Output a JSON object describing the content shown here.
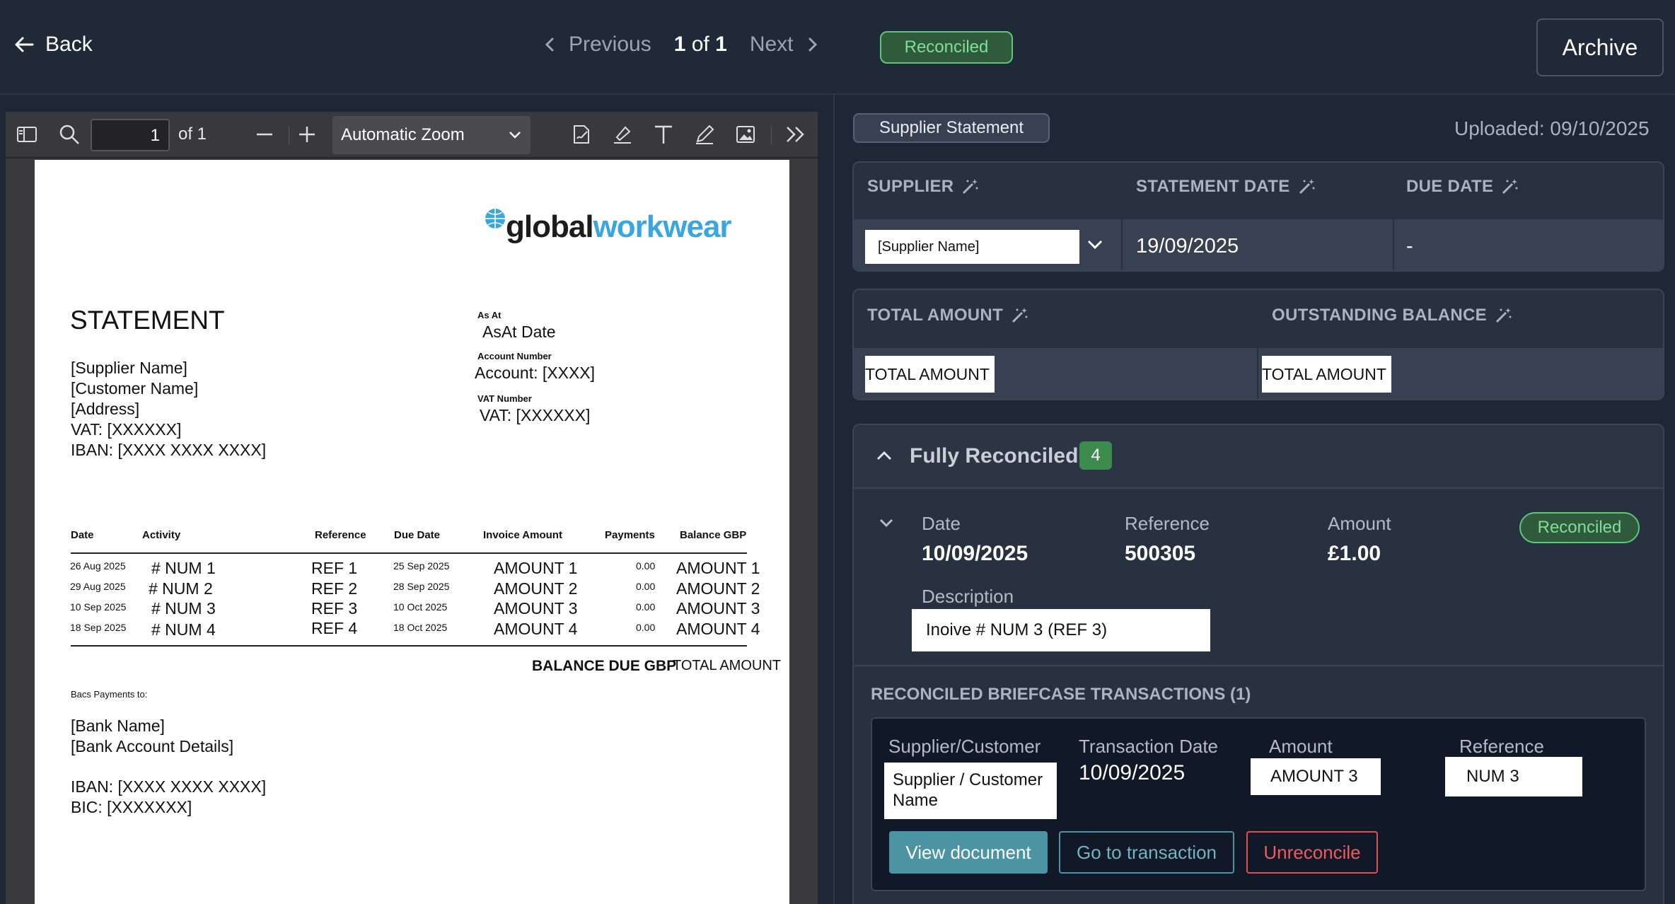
{
  "topbar": {
    "back": "Back",
    "previous": "Previous",
    "page_current": "1",
    "page_of": "of",
    "page_total": "1",
    "next": "Next",
    "status": "Reconciled",
    "archive": "Archive"
  },
  "pdf_toolbar": {
    "page_input": "1",
    "page_of": "of 1",
    "zoom": "Automatic Zoom"
  },
  "document": {
    "logo_a": "global",
    "logo_b": "workwear",
    "title": "STATEMENT",
    "as_at_label": "As At",
    "as_at_value": "AsAt Date",
    "account_label": "Account Number",
    "account_value": "Account: [XXXX]",
    "vat_label": "VAT Number",
    "vat_value": "VAT: [XXXXXX]",
    "address_lines": [
      "[Supplier Name]",
      "[Customer Name]",
      "[Address]",
      "VAT: [XXXXXX]",
      "IBAN: [XXXX XXXX XXXX]"
    ],
    "columns": [
      "Date",
      "Activity",
      "Reference",
      "Due Date",
      "Invoice Amount",
      "Payments",
      "Balance GBP"
    ],
    "rows": [
      [
        "26 Aug 2025",
        "# NUM 1",
        "REF 1",
        "25 Sep 2025",
        "AMOUNT 1",
        "0.00",
        "AMOUNT 1"
      ],
      [
        "29 Aug 2025",
        "# NUM 2",
        "REF 2",
        "28 Sep 2025",
        "AMOUNT 2",
        "0.00",
        "AMOUNT 2"
      ],
      [
        "10 Sep 2025",
        "# NUM 3",
        "REF 3",
        "10 Oct 2025",
        "AMOUNT 3",
        "0.00",
        "AMOUNT 3"
      ],
      [
        "18 Sep 2025",
        "# NUM 4",
        "REF 4",
        "18 Oct 2025",
        "AMOUNT 4",
        "0.00",
        "AMOUNT 4"
      ]
    ],
    "balance_due_label": "BALANCE DUE GBP",
    "balance_due_value": "TOTAL AMOUNT",
    "bacs_label": "Bacs Payments to:",
    "bank_lines": [
      "[Bank Name]",
      "[Bank Account Details]"
    ],
    "iban": "IBAN: [XXXX XXXX XXXX]",
    "bic": "BIC: [XXXXXXX]"
  },
  "panel": {
    "doc_type": "Supplier Statement",
    "uploaded": "Uploaded: 09/10/2025",
    "supplier_label": "SUPPLIER",
    "statement_date_label": "STATEMENT DATE",
    "due_date_label": "DUE DATE",
    "supplier_value": "[Supplier Name]",
    "statement_date_value": "19/09/2025",
    "due_date_value": "-",
    "total_amount_label": "TOTAL AMOUNT",
    "outstanding_label": "OUTSTANDING BALANCE",
    "total_amount_value": "TOTAL AMOUNT",
    "outstanding_value": "TOTAL AMOUNT",
    "section_title": "Fully Reconciled",
    "section_count": "4",
    "item": {
      "date_label": "Date",
      "date_value": "10/09/2025",
      "ref_label": "Reference",
      "ref_value": "500305",
      "amount_label": "Amount",
      "amount_value": "£1.00",
      "status": "Reconciled",
      "desc_label": "Description",
      "desc_value": "Inoive # NUM 3 (REF 3)"
    },
    "briefcase_title": "RECONCILED BRIEFCASE TRANSACTIONS (1)",
    "tx": {
      "supplier_label": "Supplier/Customer",
      "supplier_value": "Supplier / Customer Name",
      "date_label": "Transaction Date",
      "date_value": "10/09/2025",
      "amount_label": "Amount",
      "amount_value": "AMOUNT 3",
      "ref_label": "Reference",
      "ref_value": "NUM 3"
    },
    "btn_view": "View document",
    "btn_goto": "Go to transaction",
    "btn_unrec": "Unreconcile"
  }
}
